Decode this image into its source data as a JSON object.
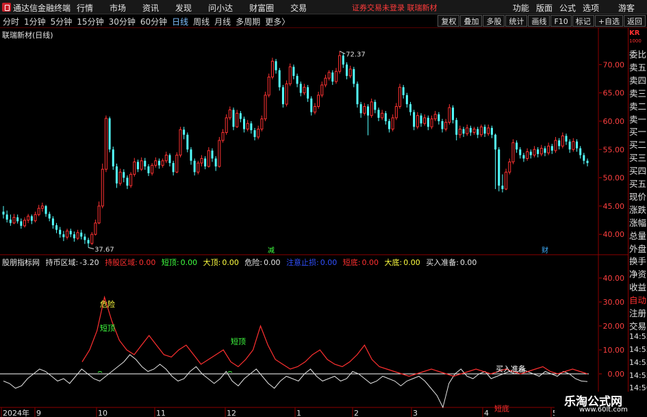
{
  "app": {
    "title": "通达信金融终端",
    "menu": [
      "行情",
      "市场",
      "资讯",
      "发现",
      "问小达",
      "财富圈",
      "交易"
    ],
    "status": "证券交易未登录   联瑞新材",
    "right_menu": [
      "功能",
      "版面",
      "公式",
      "选项"
    ],
    "guest": "游客"
  },
  "toolbar": {
    "periods": [
      "分时",
      "1分钟",
      "5分钟",
      "15分钟",
      "30分钟",
      "60分钟",
      "日线",
      "周线",
      "月线",
      "多周期",
      "更多"
    ],
    "active_period": "日线",
    "more_arrow": "〉",
    "buttons": [
      "复权",
      "叠加",
      "多股",
      "统计",
      "画线",
      "F10",
      "标记",
      "+自选",
      "返回"
    ]
  },
  "main_panel": {
    "title": "联瑞新材(日线)",
    "high_label": "72.37",
    "low_label": "37.67",
    "markers": [
      "减",
      "财"
    ],
    "colors": {
      "up": "#ff3232",
      "down": "#54ffff"
    }
  },
  "indicator": {
    "name": "股朋指标网",
    "fields": [
      {
        "label": "持币区域:",
        "value": "-3.20",
        "color": "#e6e6e6"
      },
      {
        "label": "持股区域:",
        "value": "0.00",
        "color": "#ff3030"
      },
      {
        "label": "短顶:",
        "value": "0.00",
        "color": "#40ff40"
      },
      {
        "label": "大顶:",
        "value": "0.00",
        "color": "#ffff40"
      },
      {
        "label": "危险:",
        "value": "0.00",
        "color": "#e6e6e6"
      },
      {
        "label": "注意止损:",
        "value": "0.00",
        "color": "#3050ff"
      },
      {
        "label": "短底:",
        "value": "0.00",
        "color": "#ff3030"
      },
      {
        "label": "大底:",
        "value": "0.00",
        "color": "#ffff40"
      },
      {
        "label": "买入准备:",
        "value": "0.00",
        "color": "#e6e6e6"
      }
    ],
    "annotations": [
      "危险",
      "短顶",
      "短顶",
      "买入准备",
      "短底"
    ]
  },
  "x_axis": [
    "2024年",
    "9",
    "10",
    "11",
    "12",
    "1",
    "2",
    "3",
    "4",
    "5"
  ],
  "side_panel": {
    "kr_top": "KR",
    "kr_bottom": "1000",
    "items": [
      "委比",
      "卖五",
      "卖四",
      "卖三",
      "卖二",
      "卖一",
      "买一",
      "买二",
      "买三",
      "买四",
      "买五",
      "现价",
      "涨跌",
      "涨幅",
      "总量",
      "外盘",
      "换手",
      "净资",
      "收益",
      "自动",
      "注册",
      "交易",
      "14:55",
      "14:55",
      "14:55",
      "14:55",
      "14:56",
      "14:56",
      "14:56"
    ]
  },
  "watermark": {
    "main": "乐淘公式网",
    "sub": "www.60lt.com"
  },
  "chart_data": {
    "type": "candlestick",
    "price_ylim": [
      37,
      75
    ],
    "price_ticks": [
      40.0,
      45.0,
      50.0,
      55.0,
      60.0,
      65.0,
      70.0
    ],
    "indicator_ylim": [
      -14,
      46
    ],
    "indicator_ticks": [
      -10.0,
      0.0,
      10.0,
      20.0,
      30.0,
      40.0
    ],
    "candles": [
      [
        44.0,
        43.5,
        45.0,
        42.8
      ],
      [
        43.5,
        42.6,
        44.2,
        42.1
      ],
      [
        42.6,
        42.0,
        43.5,
        41.5
      ],
      [
        42.0,
        43.0,
        43.6,
        41.8
      ],
      [
        43.0,
        42.3,
        43.5,
        41.9
      ],
      [
        42.3,
        41.5,
        42.8,
        41.0
      ],
      [
        41.5,
        42.5,
        43.0,
        41.2
      ],
      [
        42.5,
        43.2,
        43.6,
        42.0
      ],
      [
        43.2,
        42.4,
        43.5,
        41.8
      ],
      [
        42.4,
        43.5,
        44.0,
        42.1
      ],
      [
        43.5,
        44.6,
        45.2,
        43.2
      ],
      [
        44.6,
        45.0,
        45.6,
        44.0
      ],
      [
        45.0,
        43.6,
        45.2,
        43.1
      ],
      [
        43.6,
        42.8,
        44.0,
        42.3
      ],
      [
        42.8,
        41.6,
        43.2,
        41.0
      ],
      [
        41.6,
        40.8,
        42.0,
        40.2
      ],
      [
        40.8,
        40.0,
        41.3,
        39.4
      ],
      [
        40.0,
        39.5,
        40.6,
        38.8
      ],
      [
        39.5,
        40.6,
        41.0,
        39.1
      ],
      [
        40.6,
        40.0,
        41.0,
        39.5
      ],
      [
        40.0,
        39.3,
        40.5,
        38.7
      ],
      [
        39.3,
        40.3,
        40.8,
        39.0
      ],
      [
        40.3,
        39.6,
        40.8,
        39.1
      ],
      [
        39.6,
        39.0,
        40.1,
        38.3
      ],
      [
        39.0,
        38.4,
        39.4,
        37.67
      ],
      [
        38.4,
        40.0,
        40.4,
        38.1
      ],
      [
        40.0,
        42.0,
        42.6,
        39.8
      ],
      [
        42.0,
        45.0,
        45.8,
        41.8
      ],
      [
        45.0,
        51.5,
        52.5,
        44.6
      ],
      [
        51.5,
        60.5,
        61.0,
        51.0
      ],
      [
        60.5,
        55.0,
        60.8,
        54.5
      ],
      [
        55.0,
        52.0,
        55.5,
        51.4
      ],
      [
        52.0,
        49.0,
        52.5,
        48.2
      ],
      [
        49.0,
        51.0,
        51.6,
        48.6
      ],
      [
        51.0,
        50.0,
        51.5,
        49.2
      ],
      [
        50.0,
        48.6,
        50.4,
        48.0
      ],
      [
        48.6,
        50.6,
        51.0,
        48.2
      ],
      [
        50.6,
        52.8,
        53.5,
        50.2
      ],
      [
        52.8,
        51.5,
        53.2,
        51.0
      ],
      [
        51.5,
        53.0,
        53.6,
        51.2
      ],
      [
        53.0,
        52.0,
        53.5,
        51.4
      ],
      [
        52.0,
        50.8,
        52.4,
        50.3
      ],
      [
        50.8,
        52.2,
        52.6,
        50.4
      ],
      [
        52.2,
        53.0,
        53.6,
        51.8
      ],
      [
        53.0,
        52.2,
        53.4,
        51.6
      ],
      [
        52.2,
        53.0,
        53.4,
        51.8
      ],
      [
        53.0,
        54.0,
        54.6,
        52.6
      ],
      [
        54.0,
        52.6,
        54.3,
        52.0
      ],
      [
        52.6,
        51.0,
        53.0,
        50.4
      ],
      [
        51.0,
        54.0,
        54.5,
        50.8
      ],
      [
        54.0,
        58.5,
        59.0,
        53.6
      ],
      [
        58.5,
        57.6,
        59.0,
        56.8
      ],
      [
        57.6,
        55.0,
        58.0,
        54.5
      ],
      [
        55.0,
        53.0,
        55.4,
        52.3
      ],
      [
        53.0,
        51.0,
        53.4,
        50.4
      ],
      [
        51.0,
        52.6,
        53.0,
        50.6
      ],
      [
        52.6,
        53.4,
        54.0,
        52.0
      ],
      [
        53.4,
        52.0,
        53.8,
        51.5
      ],
      [
        52.0,
        54.8,
        55.4,
        51.8
      ],
      [
        54.8,
        53.4,
        55.2,
        52.8
      ],
      [
        53.4,
        52.0,
        53.8,
        51.2
      ],
      [
        52.0,
        56.6,
        57.2,
        51.8
      ],
      [
        56.6,
        58.0,
        58.6,
        56.2
      ],
      [
        58.0,
        60.6,
        61.2,
        57.6
      ],
      [
        60.6,
        62.0,
        62.6,
        60.2
      ],
      [
        62.0,
        59.0,
        62.4,
        58.4
      ],
      [
        59.0,
        61.4,
        62.0,
        58.8
      ],
      [
        61.4,
        60.4,
        61.8,
        59.8
      ],
      [
        60.4,
        58.6,
        60.8,
        58.0
      ],
      [
        58.6,
        59.6,
        60.2,
        58.2
      ],
      [
        59.6,
        58.4,
        60.0,
        57.8
      ],
      [
        58.4,
        57.2,
        58.8,
        56.6
      ],
      [
        57.2,
        58.6,
        59.2,
        56.8
      ],
      [
        58.6,
        60.4,
        61.0,
        58.2
      ],
      [
        60.4,
        64.6,
        65.2,
        60.0
      ],
      [
        64.6,
        67.8,
        68.4,
        64.2
      ],
      [
        67.8,
        70.6,
        71.2,
        67.4
      ],
      [
        70.6,
        69.0,
        71.0,
        68.4
      ],
      [
        69.0,
        66.0,
        69.4,
        65.4
      ],
      [
        66.0,
        63.0,
        66.4,
        62.4
      ],
      [
        63.0,
        66.6,
        67.2,
        62.6
      ],
      [
        66.6,
        69.6,
        70.2,
        66.2
      ],
      [
        69.6,
        68.0,
        70.0,
        67.4
      ],
      [
        68.0,
        66.6,
        68.4,
        66.0
      ],
      [
        66.6,
        65.0,
        67.0,
        64.4
      ],
      [
        65.0,
        66.0,
        66.6,
        64.6
      ],
      [
        66.0,
        64.0,
        66.4,
        63.4
      ],
      [
        64.0,
        61.6,
        64.4,
        61.0
      ],
      [
        61.6,
        62.6,
        63.2,
        61.2
      ],
      [
        62.6,
        64.6,
        65.2,
        62.2
      ],
      [
        64.6,
        66.4,
        67.0,
        64.2
      ],
      [
        66.4,
        67.6,
        68.2,
        66.0
      ],
      [
        67.6,
        68.6,
        69.0,
        67.2
      ],
      [
        68.6,
        67.0,
        69.0,
        66.4
      ],
      [
        67.0,
        68.8,
        69.4,
        66.6
      ],
      [
        68.8,
        71.6,
        72.37,
        68.4
      ],
      [
        71.6,
        70.0,
        72.0,
        69.4
      ],
      [
        70.0,
        68.0,
        70.4,
        67.4
      ],
      [
        68.0,
        69.2,
        69.8,
        67.6
      ],
      [
        69.2,
        66.6,
        69.6,
        66.0
      ],
      [
        66.6,
        63.0,
        67.0,
        62.4
      ],
      [
        63.0,
        61.4,
        63.4,
        60.6
      ],
      [
        61.4,
        62.6,
        63.2,
        61.0
      ],
      [
        62.6,
        61.0,
        63.0,
        57.5
      ],
      [
        61.0,
        63.4,
        64.0,
        60.6
      ],
      [
        63.4,
        62.0,
        63.8,
        61.4
      ],
      [
        62.0,
        60.6,
        62.4,
        60.0
      ],
      [
        60.6,
        61.4,
        62.0,
        60.2
      ],
      [
        61.4,
        60.0,
        61.8,
        59.4
      ],
      [
        60.0,
        58.6,
        60.4,
        58.0
      ],
      [
        58.6,
        60.6,
        61.2,
        58.2
      ],
      [
        60.6,
        62.6,
        63.2,
        60.2
      ],
      [
        62.6,
        66.0,
        66.6,
        62.2
      ],
      [
        66.0,
        64.6,
        66.4,
        64.0
      ],
      [
        64.6,
        63.0,
        65.0,
        62.4
      ],
      [
        63.0,
        61.6,
        63.4,
        61.0
      ],
      [
        61.6,
        59.0,
        62.0,
        58.4
      ],
      [
        59.0,
        61.0,
        61.6,
        58.6
      ],
      [
        61.0,
        59.6,
        61.4,
        59.0
      ],
      [
        59.6,
        60.6,
        61.2,
        59.2
      ],
      [
        60.6,
        59.0,
        61.0,
        58.4
      ],
      [
        59.0,
        60.4,
        61.0,
        58.6
      ],
      [
        60.4,
        61.2,
        61.8,
        60.0
      ],
      [
        61.2,
        60.0,
        61.6,
        59.4
      ],
      [
        60.0,
        58.6,
        60.4,
        58.0
      ],
      [
        58.6,
        59.8,
        60.4,
        58.2
      ],
      [
        59.8,
        62.4,
        63.0,
        59.4
      ],
      [
        62.4,
        60.2,
        62.8,
        59.6
      ],
      [
        60.2,
        57.6,
        60.6,
        56.6
      ],
      [
        57.6,
        58.6,
        59.2,
        57.0
      ],
      [
        58.6,
        57.8,
        59.0,
        57.2
      ],
      [
        57.8,
        58.8,
        59.4,
        57.4
      ],
      [
        58.8,
        58.0,
        59.2,
        57.4
      ],
      [
        58.0,
        58.6,
        59.0,
        57.6
      ],
      [
        58.6,
        57.6,
        59.0,
        57.0
      ],
      [
        57.6,
        59.0,
        59.4,
        57.2
      ],
      [
        59.0,
        57.8,
        59.4,
        57.2
      ],
      [
        57.8,
        58.8,
        59.4,
        57.4
      ],
      [
        58.8,
        57.6,
        59.2,
        57.0
      ],
      [
        57.6,
        55.0,
        57.8,
        48.0
      ],
      [
        55.0,
        48.6,
        55.4,
        47.6
      ],
      [
        48.6,
        48.0,
        50.6,
        47.4
      ],
      [
        48.0,
        51.0,
        51.6,
        47.8
      ],
      [
        51.0,
        52.8,
        53.4,
        50.6
      ],
      [
        52.8,
        56.2,
        56.8,
        52.4
      ],
      [
        56.2,
        55.0,
        56.6,
        54.4
      ],
      [
        55.0,
        54.0,
        55.4,
        53.4
      ],
      [
        54.0,
        53.4,
        54.4,
        52.8
      ],
      [
        53.4,
        54.6,
        55.2,
        53.0
      ],
      [
        54.6,
        54.0,
        55.0,
        53.4
      ],
      [
        54.0,
        55.0,
        55.6,
        53.6
      ],
      [
        55.0,
        54.2,
        55.4,
        53.6
      ],
      [
        54.2,
        55.2,
        55.8,
        53.8
      ],
      [
        55.2,
        54.4,
        55.6,
        53.8
      ],
      [
        54.4,
        55.6,
        56.2,
        54.0
      ],
      [
        55.6,
        54.8,
        56.0,
        54.2
      ],
      [
        54.8,
        56.6,
        57.2,
        54.4
      ],
      [
        56.6,
        55.6,
        57.0,
        55.0
      ],
      [
        55.6,
        57.4,
        58.0,
        55.2
      ],
      [
        57.4,
        56.4,
        57.8,
        55.8
      ],
      [
        56.4,
        55.0,
        56.8,
        54.4
      ],
      [
        55.0,
        56.4,
        57.0,
        54.6
      ],
      [
        56.4,
        55.2,
        56.8,
        54.6
      ],
      [
        55.2,
        54.0,
        55.6,
        53.4
      ],
      [
        54.0,
        53.0,
        54.4,
        52.4
      ],
      [
        53.0,
        52.6,
        53.4,
        52.0
      ]
    ],
    "indicator_white": [
      -3,
      -4,
      -6,
      -5,
      -2,
      0,
      2,
      1,
      -1,
      -3,
      -2,
      -4,
      -1,
      2,
      0,
      -2,
      -3,
      -1,
      1,
      3,
      5,
      8,
      6,
      3,
      1,
      2,
      4,
      2,
      -1,
      -3,
      -2,
      1,
      3,
      0,
      -2,
      -4,
      -2,
      1,
      -3,
      -5,
      -2,
      0,
      2,
      -1,
      -4,
      -6,
      -3,
      -1,
      -2,
      -3,
      0,
      2,
      -1,
      -3,
      -2,
      -1,
      -3,
      -2,
      1,
      0,
      -2,
      -4,
      -3,
      -1,
      -2,
      -3,
      -5,
      -3,
      -2,
      -1,
      -3,
      -6,
      -9,
      -14,
      -4,
      0,
      2,
      -1,
      -2,
      0,
      1,
      -2,
      -1,
      0,
      1,
      0,
      2,
      1,
      0,
      -1,
      1,
      0,
      -1,
      1,
      0,
      -2,
      -3,
      -3.2
    ],
    "indicator_red": [
      5,
      10,
      18,
      32,
      22,
      14,
      10,
      8,
      12,
      16,
      12,
      8,
      7,
      10,
      12,
      8,
      4,
      6,
      8,
      10,
      5,
      3,
      6,
      10,
      20,
      12,
      6,
      4,
      2,
      3,
      5,
      8,
      10,
      6,
      4,
      3,
      5,
      8,
      12,
      6,
      3,
      2,
      1,
      0,
      -1,
      0,
      1,
      2,
      1,
      0,
      -1,
      0,
      1,
      2,
      1,
      0,
      1,
      2,
      1,
      0,
      1,
      2,
      3,
      1,
      0,
      1,
      2,
      1,
      0
    ]
  }
}
